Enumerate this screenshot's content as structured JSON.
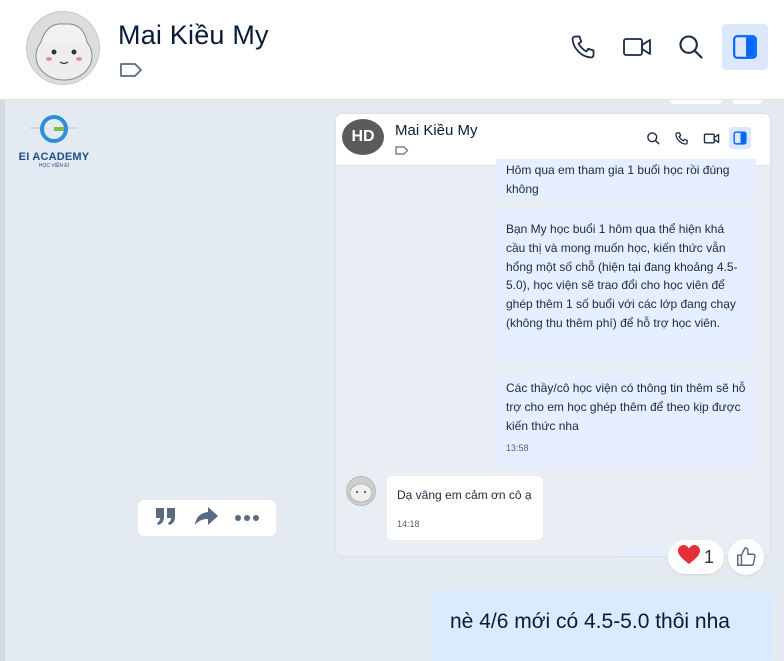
{
  "header": {
    "contact_name": "Mai Kiều My",
    "icons": [
      "tag-icon",
      "phone-icon",
      "video-icon",
      "search-icon",
      "sidebar-toggle-icon"
    ],
    "accent": "#0068ff"
  },
  "logo": {
    "brand": "EI ACADEMY",
    "subtitle": "HỌC VIỆN EI"
  },
  "inner_screenshot": {
    "avatar_initials": "HD",
    "contact_name": "Mai Kiều My",
    "messages": [
      {
        "text": "Hôm qua em tham gia 1 buổi học rồi đúng không"
      },
      {
        "text": "Bạn My học buổi 1 hôm qua thể hiện khá cầu thị và mong muốn học, kiến thức vẫn hổng một số chỗ (hiện tại đang khoảng 4.5-5.0), học viện sẽ trao đổi cho học viên để ghép thêm 1 số buổi với các lớp đang chạy (không thu thêm phí) để hỗ trợ học viên."
      },
      {
        "text": "Các thầy/cô học viện có thông tin thêm sẽ hỗ trợ cho em học ghép thêm để theo kịp được kiến thức nha",
        "time": "13:58"
      },
      {
        "text": "Dạ vâng em cảm ơn cô ạ",
        "time": "14:18"
      }
    ]
  },
  "reaction": {
    "emoji": "❤",
    "count": "1"
  },
  "my_message": {
    "text": "nè 4/6 mới có 4.5-5.0 thôi nha"
  }
}
